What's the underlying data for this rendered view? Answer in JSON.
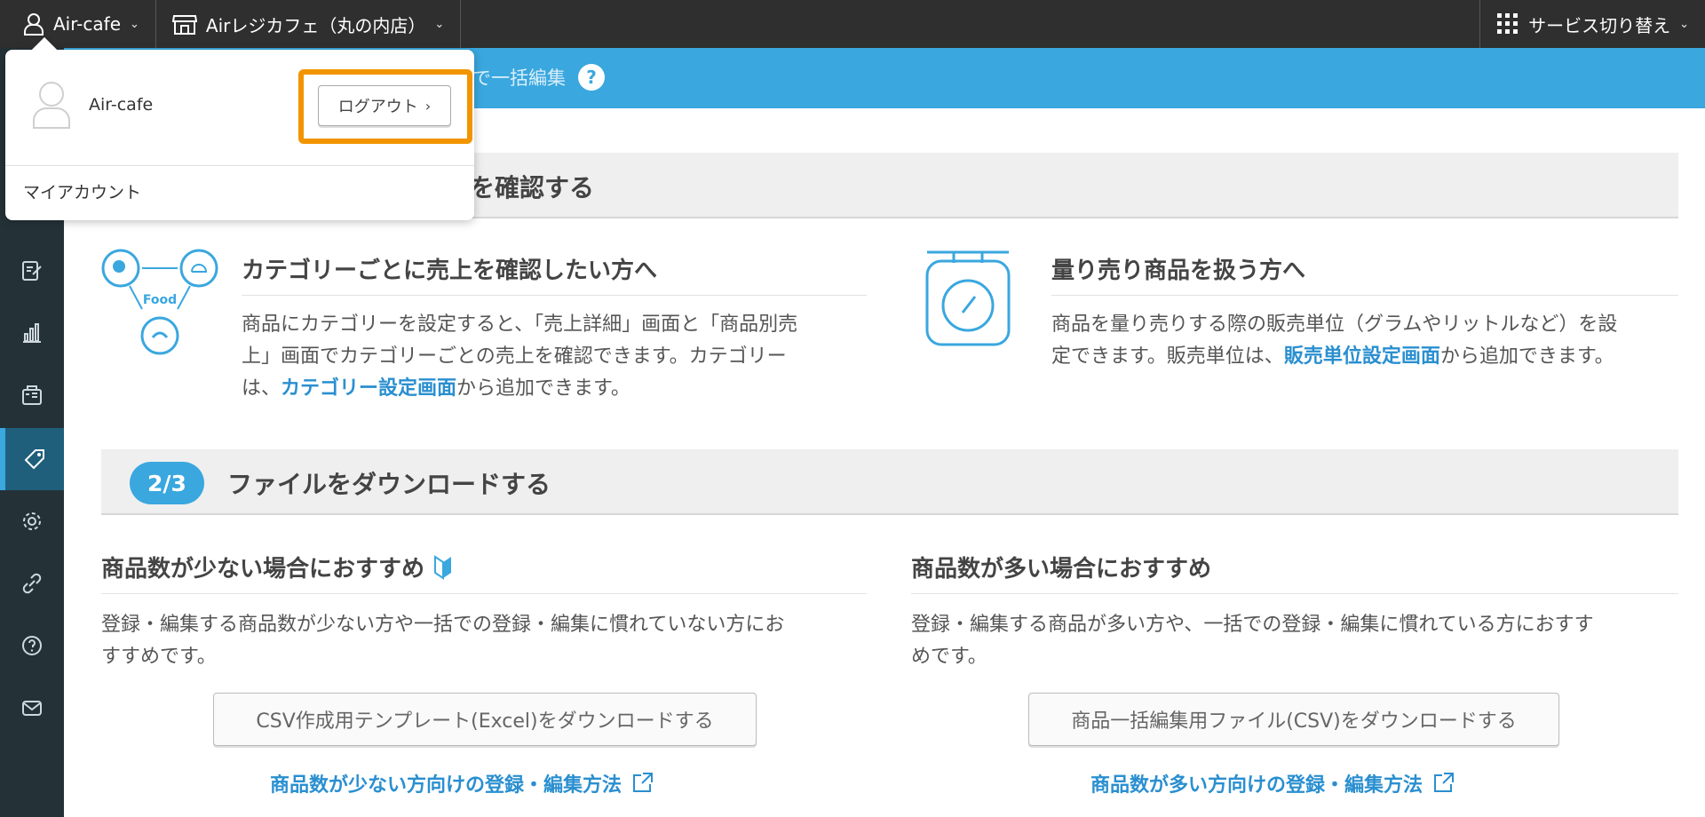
{
  "topbar": {
    "account_label": "Air-cafe",
    "store_label": "Airレジカフェ（丸の内店）",
    "switch_label": "サービス切り替え"
  },
  "subheader": {
    "title_partial": "で一括編集"
  },
  "dropdown": {
    "user_name": "Air-cafe",
    "logout_label": "ログアウト",
    "my_account_label": "マイアカウント"
  },
  "section1": {
    "title_partial": "を確認する",
    "left": {
      "heading": "カテゴリーごとに売上を確認したい方へ",
      "illustration_text": "Food",
      "line1": "商品にカテゴリーを設定すると、「売上詳細」画面と「商品別売",
      "line2": "上」画面でカテゴリーごとの売上を確認できます。カテゴリー",
      "line3_prefix": "は、",
      "line3_link": "カテゴリー設定画面",
      "line3_suffix": "から追加できます。"
    },
    "right": {
      "heading": "量り売り商品を扱う方へ",
      "line1": "商品を量り売りする際の販売単位（グラムやリットルなど）を設",
      "line2_prefix": "定できます。販売単位は、",
      "line2_link": "販売単位設定画面",
      "line2_suffix": "から追加できます。"
    }
  },
  "section2": {
    "step": "2/3",
    "title": "ファイルをダウンロードする",
    "left": {
      "heading": "商品数が少ない場合におすすめ",
      "line1": "登録・編集する商品数が少ない方や一括での登録・編集に慣れていない方にお",
      "line2": "すすめです。",
      "button": "CSV作成用テンプレート(Excel)をダウンロードする",
      "link": "商品数が少ない方向けの登録・編集方法"
    },
    "right": {
      "heading": "商品数が多い場合におすすめ",
      "line1": "登録・編集する商品が多い方や、一括での登録・編集に慣れている方におすす",
      "line2": "めです。",
      "button": "商品一括編集用ファイル(CSV)をダウンロードする",
      "link": "商品数が多い方向けの登録・編集方法"
    }
  },
  "colors": {
    "accent_blue": "#3aa7df",
    "highlight_orange": "#f29400",
    "topbar": "#2f2f2f",
    "sidebar": "#243238"
  }
}
